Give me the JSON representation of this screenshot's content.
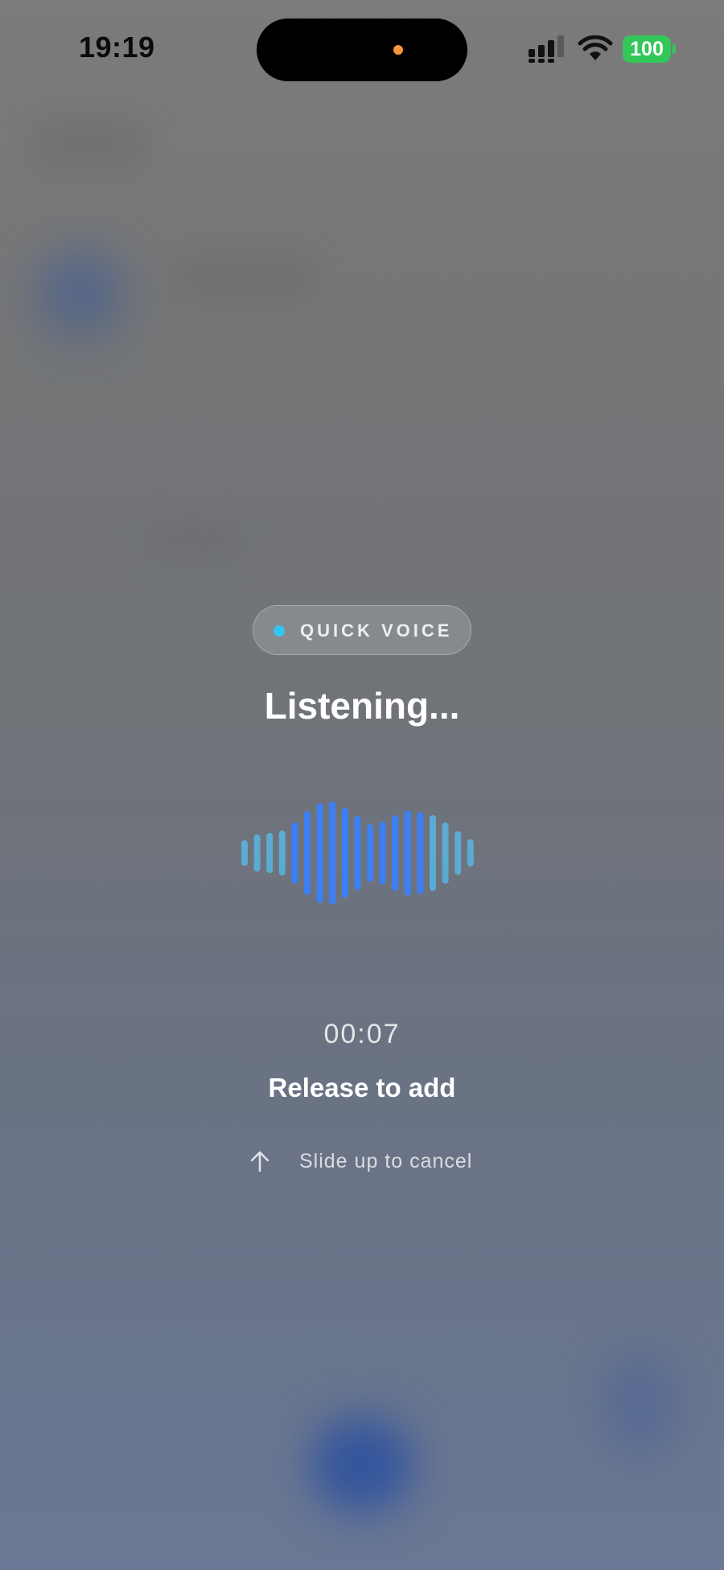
{
  "status_bar": {
    "time": "19:19",
    "battery": "100",
    "battery_color": "#33c759",
    "privacy_dot_color": "#f7953a",
    "icons": [
      "cellular-signal-icon",
      "wifi-icon",
      "battery-icon"
    ]
  },
  "voice_overlay": {
    "badge": {
      "label": "QUICK VOICE",
      "dot_color": "#33c6f2"
    },
    "title": "Listening...",
    "timer": "00:07",
    "primary_hint": "Release to add",
    "cancel_hint": "Slide up to cancel",
    "cancel_icon": "arrow-up-icon",
    "waveform_colors": {
      "edge": "#5aaed8",
      "center": "#3d7ff5"
    }
  }
}
